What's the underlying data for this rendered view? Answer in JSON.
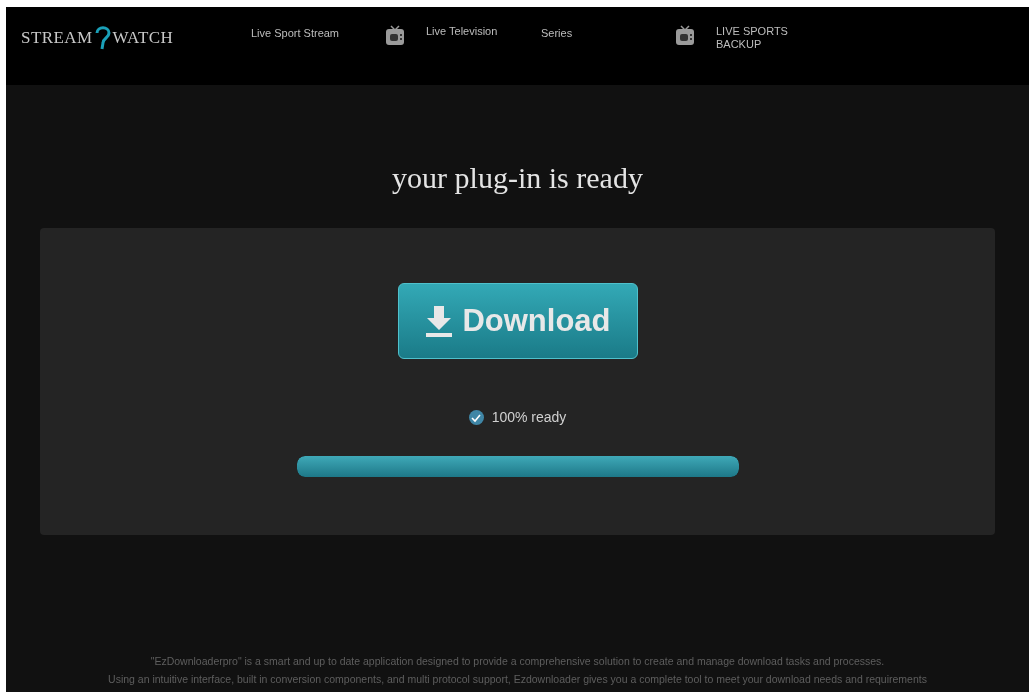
{
  "logo": {
    "left": "STREAM",
    "right": "WATCH"
  },
  "nav": [
    {
      "label": "Live Sport Stream",
      "icon": false
    },
    {
      "label": "Live Television",
      "icon": true
    },
    {
      "label": "Series",
      "icon": false
    },
    {
      "label": "LIVE SPORTS BACKUP",
      "icon": true
    }
  ],
  "heading": "your plug-in is ready",
  "download_button": "Download",
  "status": {
    "label": "100% ready",
    "checked": true
  },
  "progress": {
    "level": 1.0
  },
  "footer": [
    "\"EzDownloaderpro\" is a smart and up to date application designed to provide a comprehensive solution to create and manage download tasks and processes.",
    "Using an intuitive interface, built in conversion components, and multi protocol support, Ezdownloader gives you a complete tool to meet your download needs and requirements"
  ]
}
